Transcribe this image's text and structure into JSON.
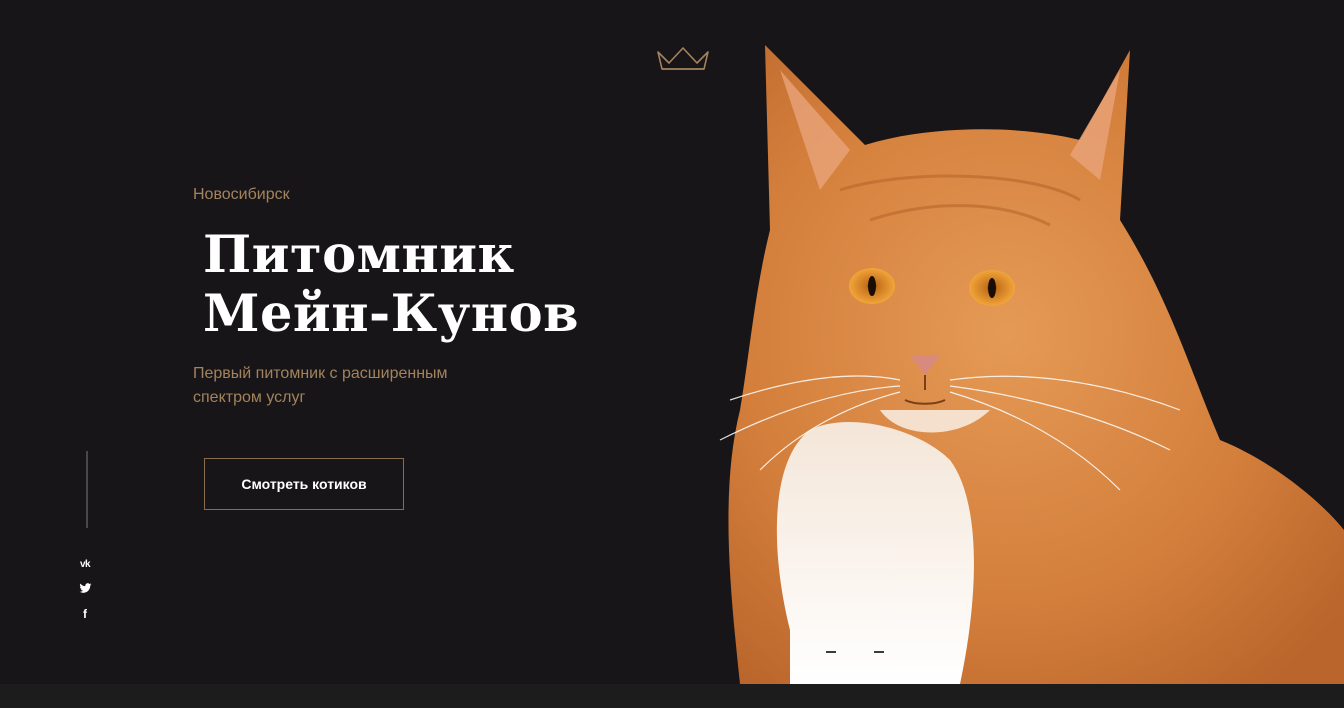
{
  "hero": {
    "city": "Новосибирск",
    "title_line1": "Питомник",
    "title_line2": "Мейн-Кунов",
    "subtitle": "Первый питомник с расширенным спектром услуг",
    "cta_label": "Смотреть котиков"
  },
  "icons": {
    "crown": "crown-icon",
    "social": [
      "vk-icon",
      "twitter-icon",
      "facebook-icon"
    ]
  },
  "social": {
    "vk": "vk",
    "facebook": "f"
  },
  "colors": {
    "background": "#171517",
    "accent": "#a3835e",
    "button_border": "#8a6c4c",
    "text": "#ffffff",
    "cat_orange": "#d9843f"
  }
}
